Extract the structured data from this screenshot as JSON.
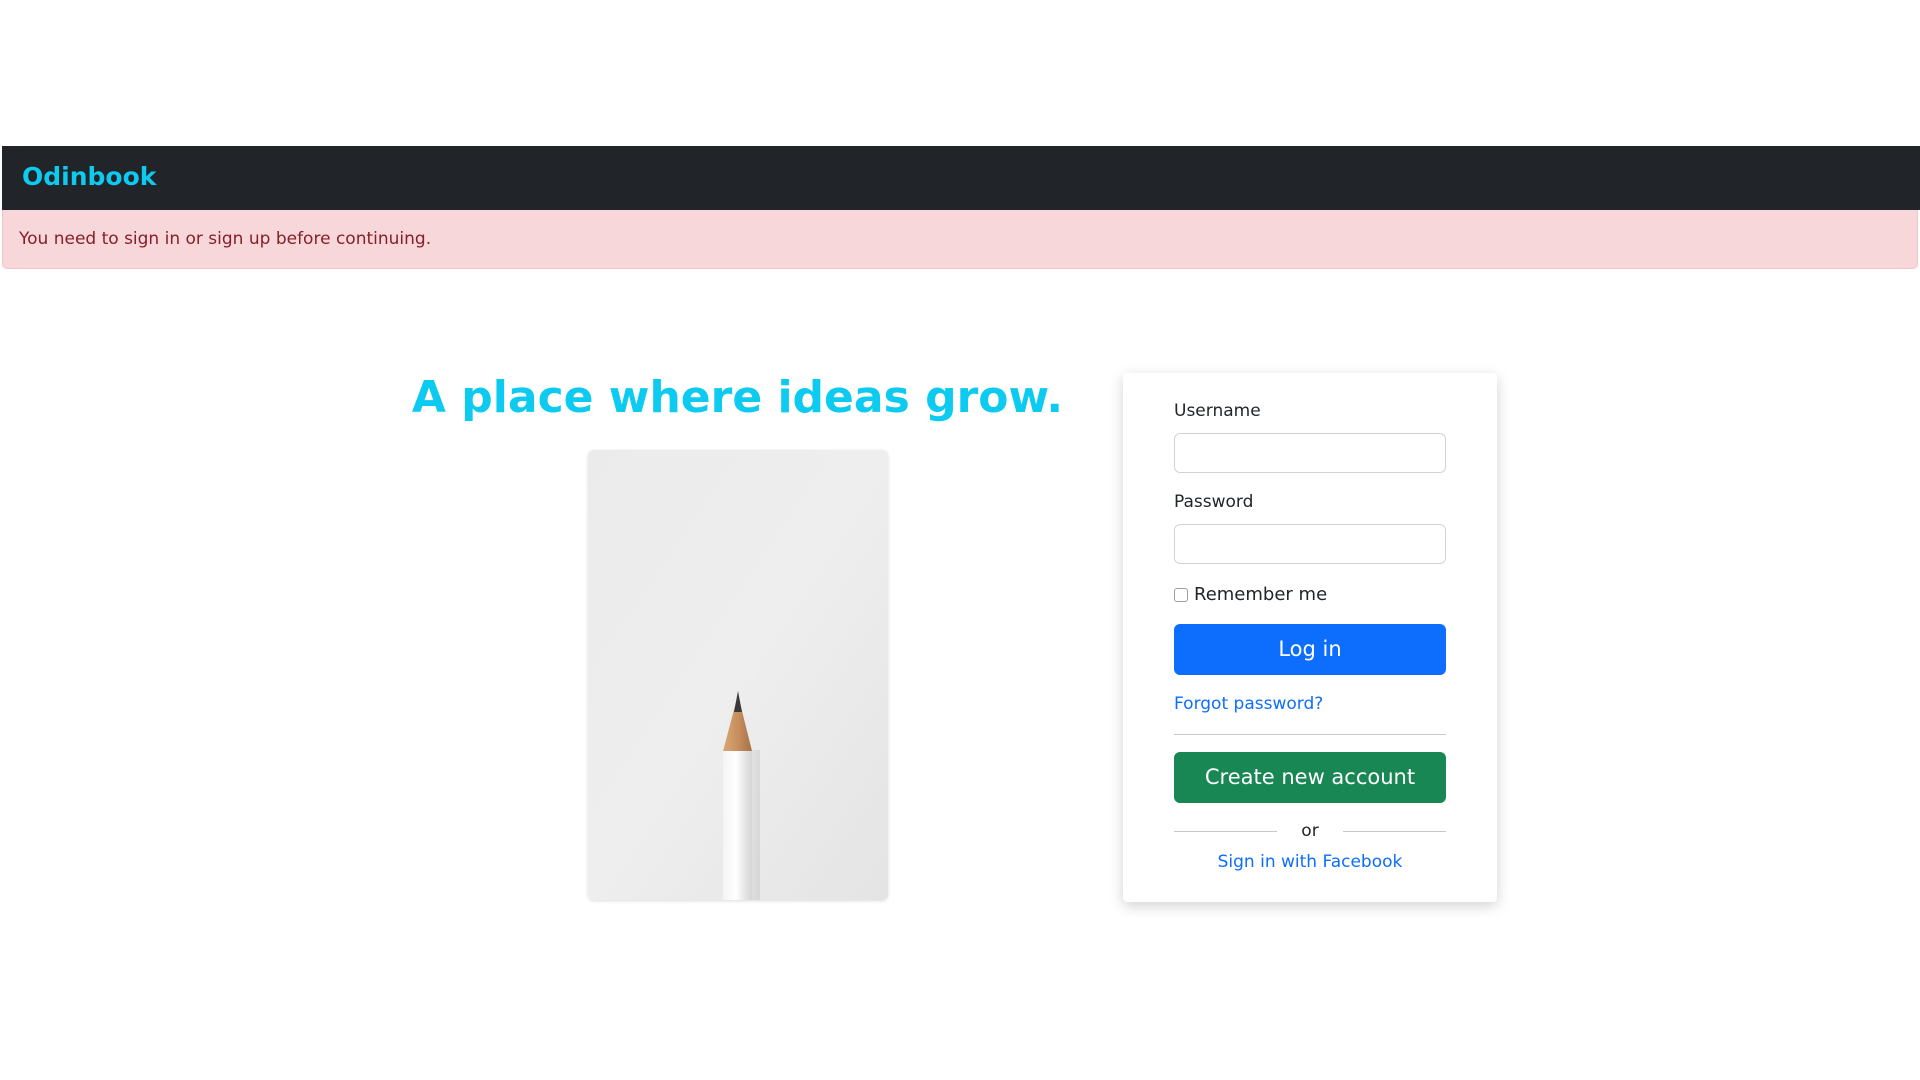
{
  "navbar": {
    "brand": "Odinbook",
    "background_color": "#212529",
    "brand_color": "#0dcaf0"
  },
  "alert": {
    "message": "You need to sign in or sign up before continuing.",
    "background_color": "#f8d7da",
    "text_color": "#842029"
  },
  "hero": {
    "tagline": "A place where ideas grow.",
    "image_description": "pencil-image"
  },
  "login_form": {
    "username_label": "Username",
    "username_value": "",
    "password_label": "Password",
    "password_value": "",
    "remember_label": "Remember me",
    "remember_checked": false,
    "login_button": "Log in",
    "forgot_link": "Forgot password?",
    "create_button": "Create new account",
    "or_text": "or",
    "facebook_link": "Sign in with Facebook"
  },
  "colors": {
    "primary": "#0d6efd",
    "success": "#198754",
    "accent": "#0dcaf0"
  }
}
